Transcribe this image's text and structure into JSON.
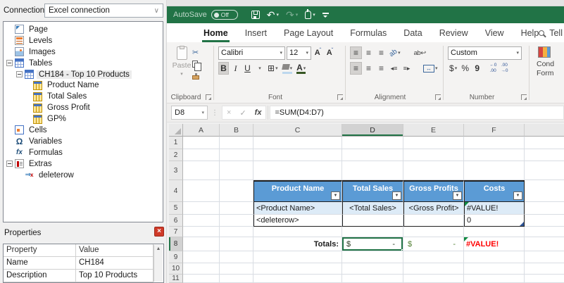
{
  "colors": {
    "excel_green": "#217346",
    "table_header_blue": "#5B9BD5",
    "banded_row_blue": "#DDEBF7",
    "error_red": "#FF0000",
    "totals_green": "#538135"
  },
  "left_panel": {
    "connection": {
      "label": "Connection",
      "value": "Excel connection"
    },
    "tree": [
      {
        "label": "Page"
      },
      {
        "label": "Levels"
      },
      {
        "label": "Images"
      },
      {
        "label": "Tables"
      },
      {
        "label": "CH184 - Top 10 Products"
      },
      {
        "label": "Product Name"
      },
      {
        "label": "Total Sales"
      },
      {
        "label": "Gross Profit"
      },
      {
        "label": "GP%"
      },
      {
        "label": "Cells"
      },
      {
        "label": "Variables"
      },
      {
        "label": "Formulas"
      },
      {
        "label": "Extras"
      },
      {
        "label": "deleterow"
      }
    ],
    "properties": {
      "title": "Properties",
      "columns": [
        "Property",
        "Value"
      ],
      "rows": [
        {
          "property": "Name",
          "value": "CH184"
        },
        {
          "property": "Description",
          "value": "Top 10 Products"
        }
      ]
    }
  },
  "excel": {
    "titlebar": {
      "autosave_label": "AutoSave",
      "autosave_state": "Off"
    },
    "tabs": [
      "Home",
      "Insert",
      "Page Layout",
      "Formulas",
      "Data",
      "Review",
      "View",
      "Help"
    ],
    "tell_me": "Tell",
    "ribbon": {
      "clipboard": {
        "group_label": "Clipboard",
        "paste_label": "Paste"
      },
      "font": {
        "group_label": "Font",
        "font_name": "Calibri",
        "font_size": "12",
        "bold": "B",
        "italic": "I",
        "underline": "U"
      },
      "alignment": {
        "group_label": "Alignment"
      },
      "number": {
        "group_label": "Number",
        "format": "Custom",
        "currency": "$",
        "percent": "%",
        "comma": "9"
      },
      "conditional": {
        "line1": "Cond",
        "line2": "Form"
      }
    },
    "formula_bar": {
      "name_box": "D8",
      "fx": "fx",
      "formula": "=SUM(D4:D7)"
    },
    "grid": {
      "column_headers": [
        "A",
        "B",
        "C",
        "D",
        "E",
        "F"
      ],
      "selected_column": "D",
      "row_numbers": [
        "1",
        "2",
        "3",
        "4",
        "5",
        "6",
        "7",
        "8",
        "9",
        "10",
        "11"
      ],
      "selected_row": "8",
      "table": {
        "headers": [
          "Product Name",
          "Total Sales",
          "Gross Profits",
          "Costs"
        ],
        "rows": [
          [
            "<Product Name>",
            "<Total Sales>",
            "<Gross Profit>",
            "#VALUE!"
          ],
          [
            "<deleterow>",
            "",
            "",
            "0"
          ]
        ],
        "totals_label": "Totals:",
        "totals": {
          "d": {
            "symbol": "$",
            "amount": "-"
          },
          "e": {
            "symbol": "$",
            "amount": "-"
          },
          "f": "#VALUE!"
        }
      }
    }
  },
  "icons": {
    "close": "×",
    "scroll_up": "▲",
    "combo_chevron": "∨",
    "chevron": "▾",
    "filter_arrow": "▼",
    "cut": "✂",
    "undo": "↶",
    "redo": "↷",
    "cancel": "×",
    "check": "✓",
    "vdots": "⋮",
    "omega": "Ω",
    "fx": "fx",
    "delete_arrow": "⇒",
    "delete_x": "x",
    "borders": "⊞",
    "merge_arrow": "↔",
    "wrap": "ab↩",
    "orientation": "ab",
    "lines": "≡",
    "indent_left": "◂≡",
    "indent_right": "≡▸",
    "grow_a": "A",
    "caret_up": "ˆ",
    "caret_down": "ˇ",
    "inc_top": "←0",
    "inc_bot": ".00",
    "dec_top": ".00",
    "dec_bot": "→0"
  }
}
